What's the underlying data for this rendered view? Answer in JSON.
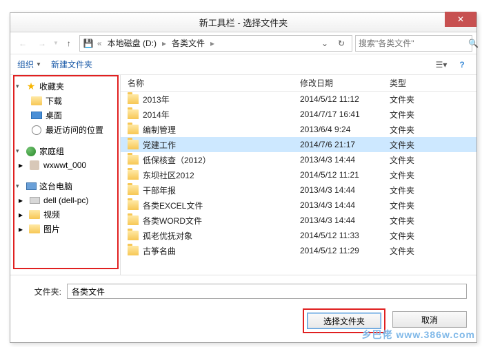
{
  "title": "新工具栏 - 选择文件夹",
  "address": {
    "drive": "本地磁盘 (D:)",
    "folder": "各类文件"
  },
  "search": {
    "placeholder": "搜索\"各类文件\""
  },
  "toolbar": {
    "organize": "组织",
    "newfolder": "新建文件夹"
  },
  "sidebar": {
    "favorites": {
      "label": "收藏夹",
      "items": [
        {
          "label": "下载",
          "icon": "folder"
        },
        {
          "label": "桌面",
          "icon": "desktop"
        },
        {
          "label": "最近访问的位置",
          "icon": "clock"
        }
      ]
    },
    "homegroup": {
      "label": "家庭组",
      "items": [
        {
          "label": "wxwwt_000",
          "icon": "user"
        }
      ]
    },
    "thispc": {
      "label": "这台电脑",
      "items": [
        {
          "label": "dell (dell-pc)",
          "icon": "drive"
        },
        {
          "label": "视频",
          "icon": "folder"
        },
        {
          "label": "图片",
          "icon": "folder"
        }
      ]
    }
  },
  "columns": {
    "name": "名称",
    "date": "修改日期",
    "type": "类型"
  },
  "files": [
    {
      "name": "2013年",
      "date": "2014/5/12 11:12",
      "type": "文件夹"
    },
    {
      "name": "2014年",
      "date": "2014/7/17 16:41",
      "type": "文件夹"
    },
    {
      "name": "编制管理",
      "date": "2013/6/4 9:24",
      "type": "文件夹"
    },
    {
      "name": "党建工作",
      "date": "2014/7/6 21:17",
      "type": "文件夹",
      "selected": true
    },
    {
      "name": "低保核查（2012）",
      "date": "2013/4/3 14:44",
      "type": "文件夹"
    },
    {
      "name": "东坝社区2012",
      "date": "2014/5/12 11:21",
      "type": "文件夹"
    },
    {
      "name": "干部年报",
      "date": "2013/4/3 14:44",
      "type": "文件夹"
    },
    {
      "name": "各类EXCEL文件",
      "date": "2013/4/3 14:44",
      "type": "文件夹"
    },
    {
      "name": "各类WORD文件",
      "date": "2013/4/3 14:44",
      "type": "文件夹"
    },
    {
      "name": "孤老优抚对象",
      "date": "2014/5/12 11:33",
      "type": "文件夹"
    },
    {
      "name": "古筝名曲",
      "date": "2014/5/12 11:29",
      "type": "文件夹"
    }
  ],
  "folder_label": "文件夹:",
  "folder_value": "各类文件",
  "buttons": {
    "select": "选择文件夹",
    "cancel": "取消"
  },
  "watermark": "乡巴佬 www.386w.com"
}
